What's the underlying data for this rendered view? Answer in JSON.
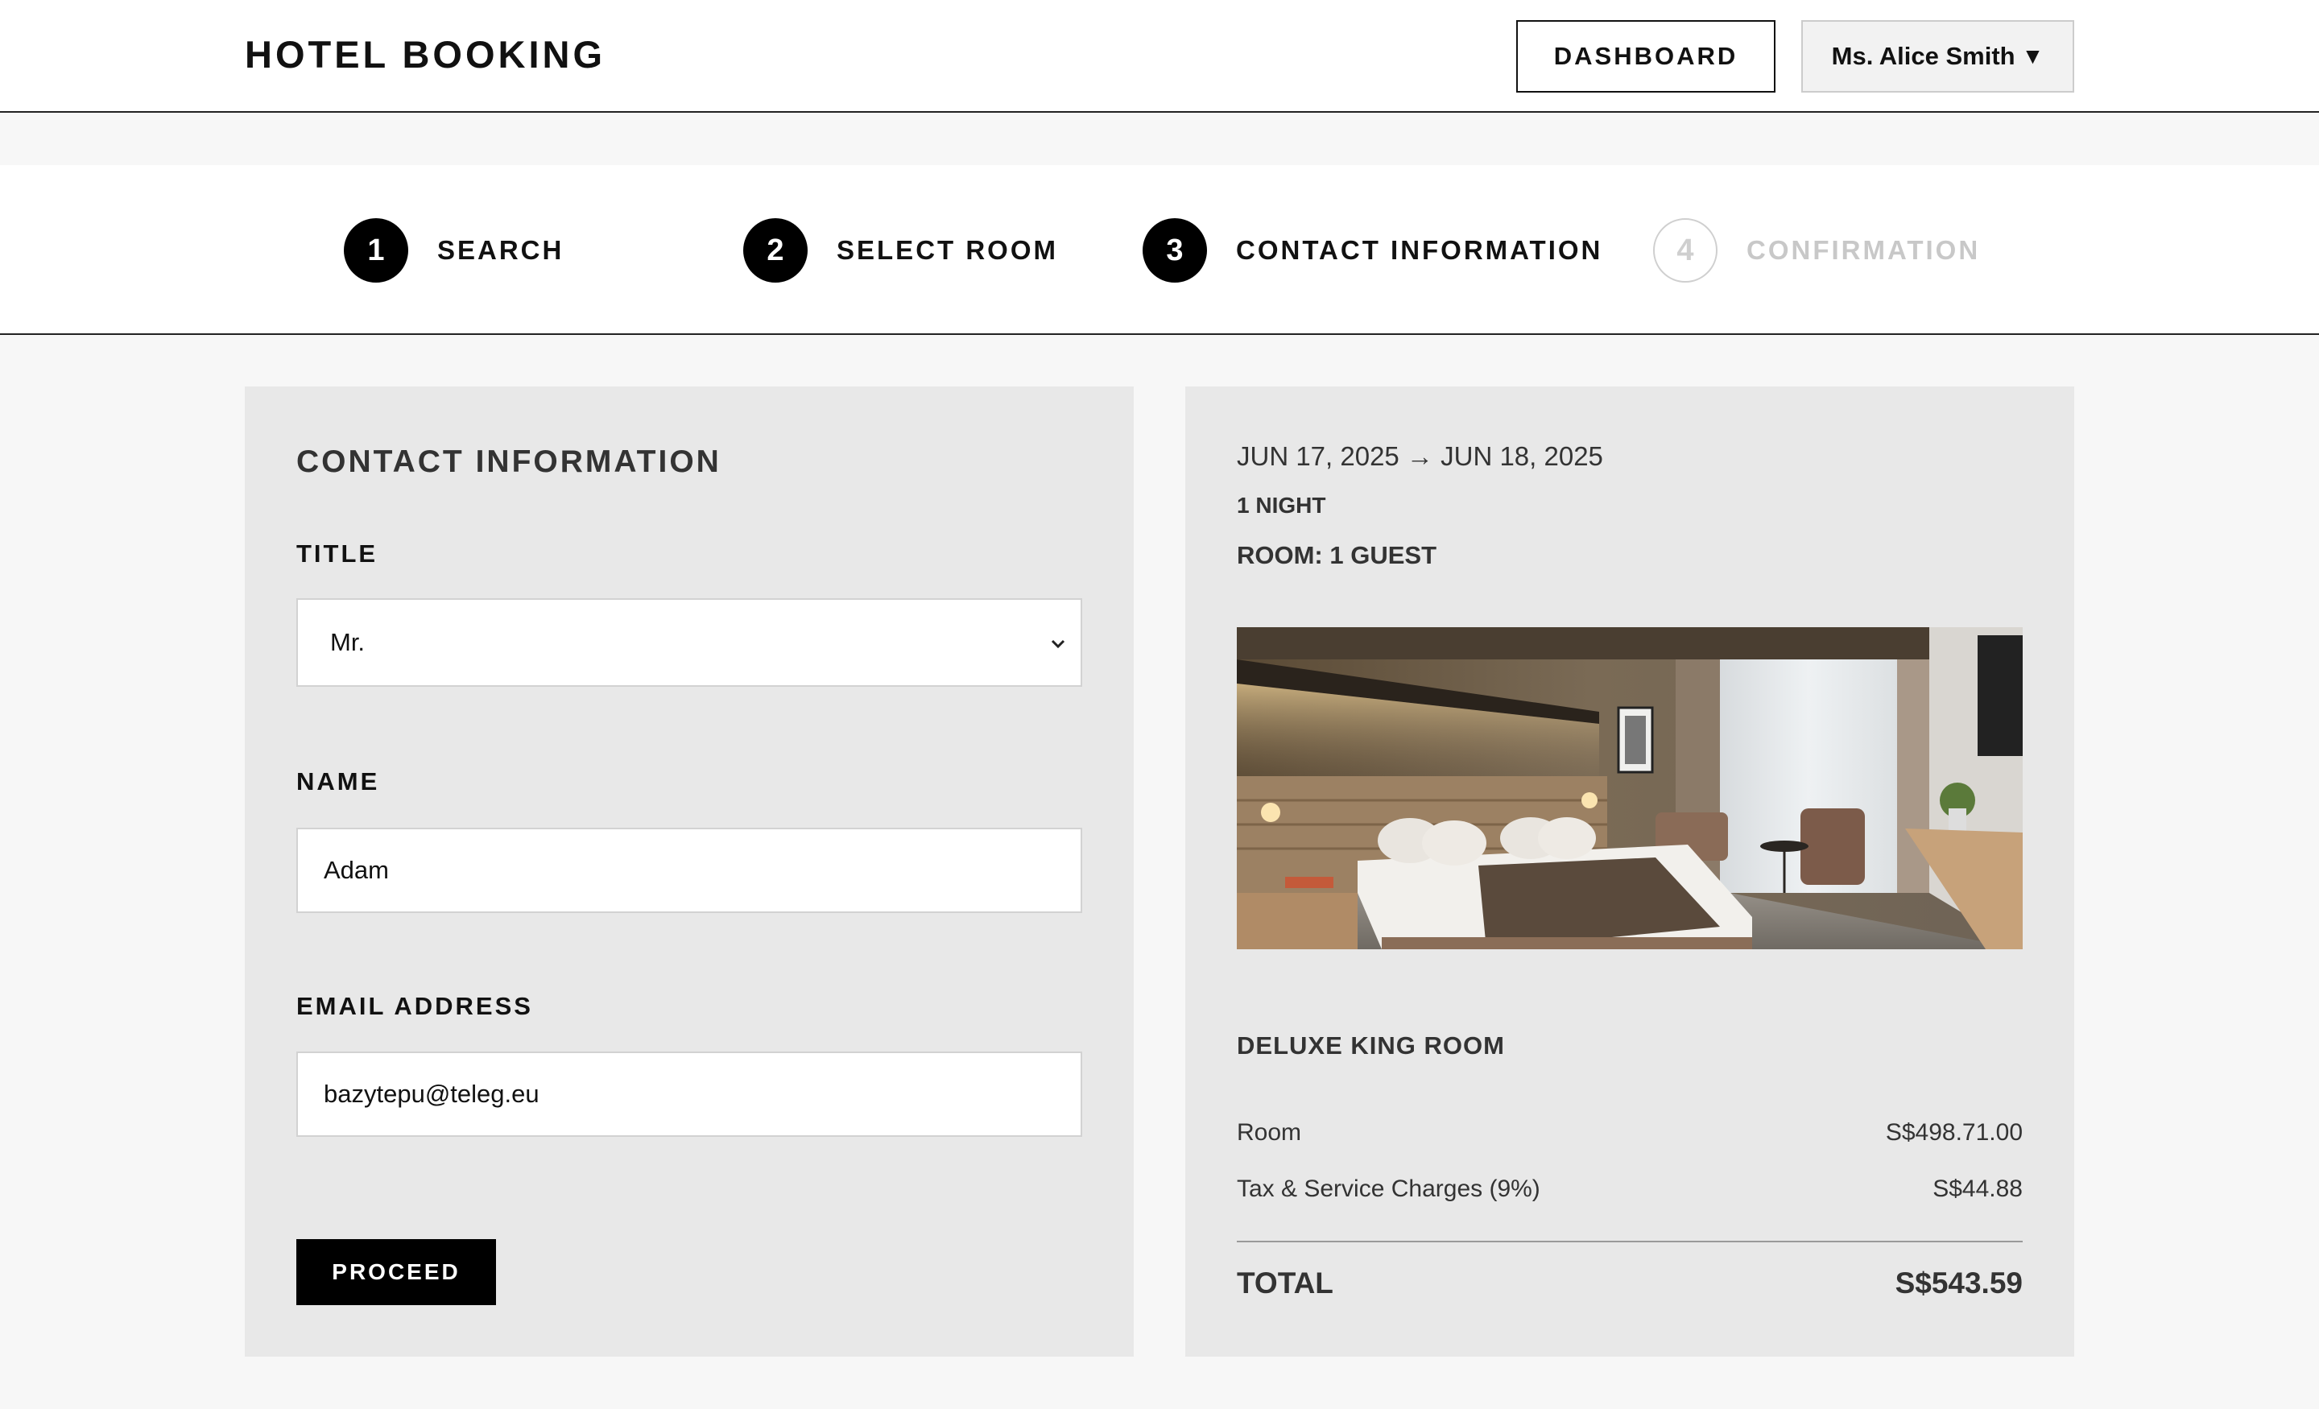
{
  "header": {
    "brand": "HOTEL BOOKING",
    "dashboard_label": "DASHBOARD",
    "user_label": "Ms. Alice Smith",
    "user_caret": "▼"
  },
  "steps": [
    {
      "number": "1",
      "label": "SEARCH",
      "state": "complete"
    },
    {
      "number": "2",
      "label": "SELECT ROOM",
      "state": "complete"
    },
    {
      "number": "3",
      "label": "CONTACT INFORMATION",
      "state": "current"
    },
    {
      "number": "4",
      "label": "CONFIRMATION",
      "state": "upcoming"
    }
  ],
  "form": {
    "title": "CONTACT INFORMATION",
    "title_field": {
      "label": "TITLE",
      "value": "Mr."
    },
    "name_field": {
      "label": "NAME",
      "value": "Adam"
    },
    "email_field": {
      "label": "EMAIL ADDRESS",
      "value": "bazytepu@teleg.eu"
    },
    "proceed_label": "PROCEED"
  },
  "summary": {
    "dates": "JUN 17, 2025 → JUN 18, 2025",
    "nights": "1 NIGHT",
    "room_guests": "ROOM: 1 GUEST",
    "room_name": "DELUXE KING ROOM",
    "room_label": "Room",
    "room_price": "S$498.71.00",
    "tax_label": "Tax & Service Charges (9%)",
    "tax_price": "S$44.88",
    "total_label": "TOTAL",
    "total_price": "S$543.59"
  },
  "colors": {
    "accent": "#000000",
    "panel_bg": "#e8e8e8",
    "page_bg": "#f7f7f7",
    "inactive": "#c8c8c8"
  }
}
